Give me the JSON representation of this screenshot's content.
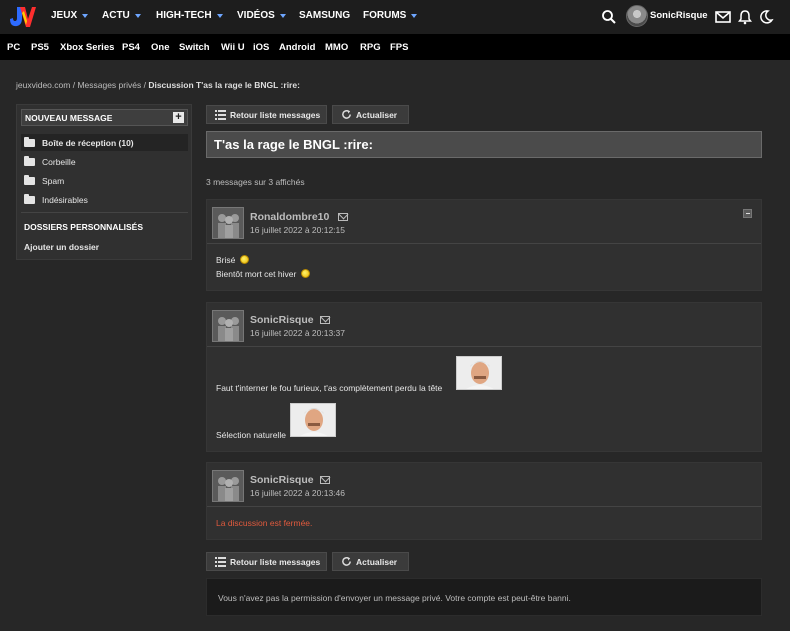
{
  "nav": {
    "items": [
      {
        "label": "JEUX",
        "caret": true
      },
      {
        "label": "ACTU",
        "caret": true
      },
      {
        "label": "HIGH-TECH",
        "caret": true
      },
      {
        "label": "VIDÉOS",
        "caret": true
      },
      {
        "label": "SAMSUNG",
        "caret": false
      },
      {
        "label": "FORUMS",
        "caret": true
      }
    ],
    "username": "SonicRisque",
    "accent": "#6ea6ff",
    "logo_colors": [
      "#2d6bff",
      "#ff2e2e",
      "#ffcc00"
    ]
  },
  "platforms": [
    "PC",
    "PS5",
    "Xbox Series",
    "PS4",
    "One",
    "Switch",
    "Wii U",
    "iOS",
    "Android",
    "MMO",
    "RPG",
    "FPS"
  ],
  "breadcrumb": {
    "part1": "jeuxvideo.com",
    "sep": " / ",
    "part2": "Messages privés",
    "current": "Discussion T'as la rage le BNGL :rire:"
  },
  "sidebar": {
    "new_message": "NOUVEAU MESSAGE",
    "folders": [
      {
        "label": "Boîte de réception (10)",
        "active": true
      },
      {
        "label": "Corbeille",
        "active": false
      },
      {
        "label": "Spam",
        "active": false
      },
      {
        "label": "Indésirables",
        "active": false
      }
    ],
    "personal_title": "DOSSIERS PERSONNALISÉS",
    "add_folder": "Ajouter un dossier"
  },
  "toolbar": {
    "back_label": "Retour liste messages",
    "refresh_label": "Actualiser"
  },
  "topic": {
    "title": "T'as la rage le BNGL :rire:",
    "count": "3 messages sur 3 affichés"
  },
  "posts": [
    {
      "author": "Ronaldombre10",
      "date": "16 juillet 2022 à 20:12:15",
      "lines": [
        "Brisé",
        "Bientôt mort cet hiver"
      ]
    },
    {
      "author": "SonicRisque",
      "date": "16 juillet 2022 à 20:13:37",
      "lines": [
        "Faut t'interner le fou furieux, t'as complètement perdu la tête",
        "Sélection naturelle"
      ]
    },
    {
      "author": "SonicRisque",
      "date": "16 juillet 2022 à 20:13:46",
      "closed": "La discussion est fermée."
    }
  ],
  "notice": "Vous n'avez pas la permission d'envoyer un message privé. Votre compte est peut-être banni."
}
